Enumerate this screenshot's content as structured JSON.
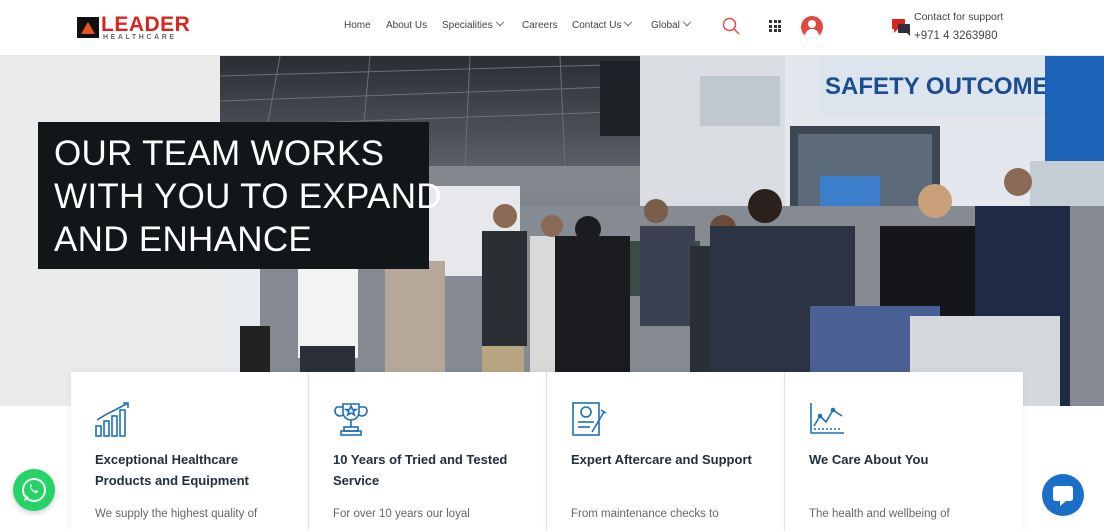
{
  "brand": {
    "name": "LEADER",
    "tagline": "HEALTHCARE"
  },
  "nav": {
    "items": [
      {
        "label": "Home",
        "has_dropdown": false
      },
      {
        "label": "About Us",
        "has_dropdown": false
      },
      {
        "label": "Specialities",
        "has_dropdown": true
      },
      {
        "label": "Careers",
        "has_dropdown": false
      },
      {
        "label": "Contact Us",
        "has_dropdown": true
      },
      {
        "label": "Global",
        "has_dropdown": true
      }
    ]
  },
  "header_icons": {
    "search": "search-icon",
    "apps": "grid-icon",
    "account": "user-icon",
    "support": "chat-bubble-icon"
  },
  "support": {
    "label": "Contact for support",
    "phone": "+971 4 3263980"
  },
  "hero": {
    "caption_lines": [
      "OUR TEAM WORKS",
      "WITH YOU TO EXPAND",
      "AND ENHANCE"
    ],
    "banner_text": "SAFETY OUTCOMES"
  },
  "cards": [
    {
      "icon": "bar-chart-icon",
      "title": "Exceptional Healthcare Products and Equipment",
      "desc": "We supply the highest quality of"
    },
    {
      "icon": "trophy-icon",
      "title": "10 Years of Tried and Tested Service",
      "desc": "For over 10 years our loyal"
    },
    {
      "icon": "document-pen-icon",
      "title": "Expert Aftercare and Support",
      "desc": "From maintenance checks to"
    },
    {
      "icon": "line-chart-icon",
      "title": "We Care About You",
      "desc": "The health and wellbeing of"
    }
  ],
  "colors": {
    "brand_red": "#d9261c",
    "accent_red": "#e0493f",
    "icon_blue": "#1f6fb5",
    "whatsapp": "#25d366",
    "chat": "#1b6fc9",
    "caption_bg": "#111618"
  }
}
